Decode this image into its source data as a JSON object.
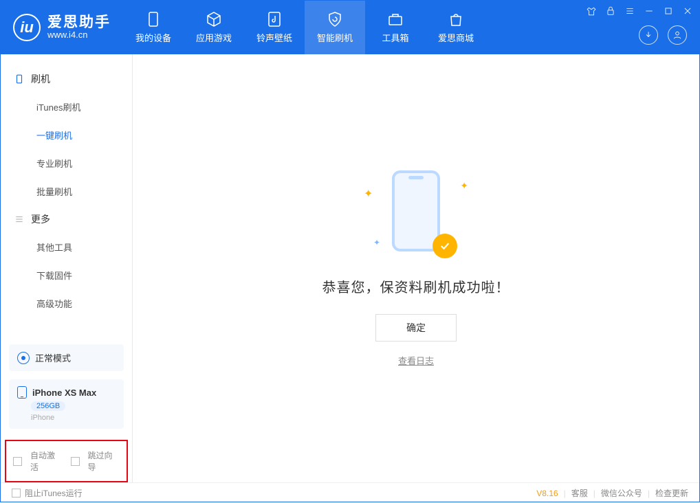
{
  "app": {
    "title": "爱思助手",
    "subtitle": "www.i4.cn"
  },
  "nav": {
    "device": "我的设备",
    "apps": "应用游戏",
    "ringtone": "铃声壁纸",
    "flash": "智能刷机",
    "toolbox": "工具箱",
    "store": "爱思商城"
  },
  "sidebar": {
    "group_flash": "刷机",
    "items": {
      "itunes": "iTunes刷机",
      "oneclick": "一键刷机",
      "pro": "专业刷机",
      "batch": "批量刷机"
    },
    "group_more": "更多",
    "more_items": {
      "other": "其他工具",
      "firmware": "下载固件",
      "advanced": "高级功能"
    },
    "mode_card": "正常模式",
    "device": {
      "name": "iPhone XS Max",
      "capacity": "256GB",
      "type": "iPhone"
    },
    "options": {
      "auto_activate": "自动激活",
      "skip_guide": "跳过向导"
    }
  },
  "content": {
    "success_msg": "恭喜您，保资料刷机成功啦！",
    "ok_btn": "确定",
    "view_log": "查看日志"
  },
  "footer": {
    "block_itunes": "阻止iTunes运行",
    "version": "V8.16",
    "support": "客服",
    "wechat": "微信公众号",
    "update": "检查更新"
  }
}
